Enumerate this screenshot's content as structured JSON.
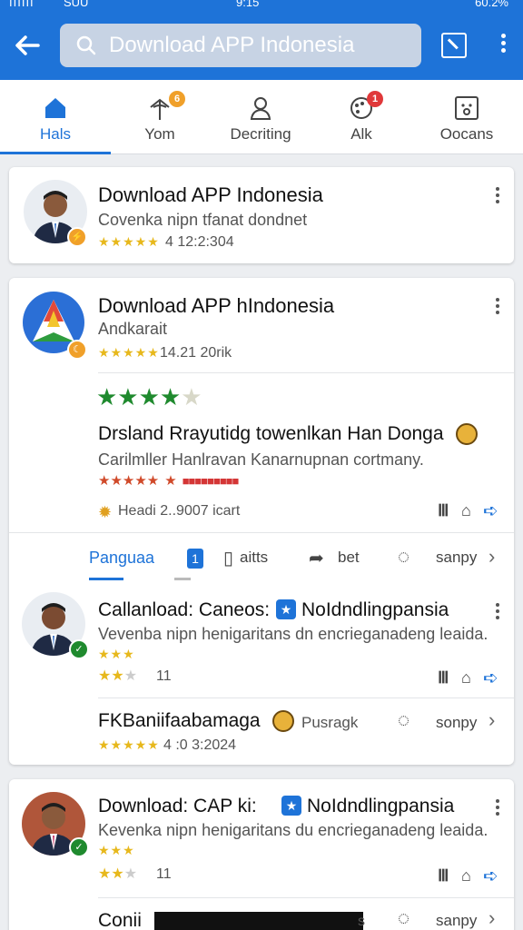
{
  "status_bar": {
    "signal": "IIIIII",
    "carrier": "SUU",
    "clock": "9:15",
    "battery": "60.2%"
  },
  "search": {
    "placeholder": "Download APP Indonesia"
  },
  "icons": {
    "back": "back-arrow-icon",
    "search": "search-icon",
    "screenshot": "crop-icon",
    "more": "more-vert-icon"
  },
  "tabs": [
    {
      "label": "Hals",
      "icon": "home-icon",
      "active": true
    },
    {
      "label": "Yom",
      "icon": "pin-icon",
      "badge": "6"
    },
    {
      "label": "Decriting",
      "icon": "person-icon"
    },
    {
      "label": "Alk",
      "icon": "palette-icon",
      "badge": "1"
    },
    {
      "label": "Oocans",
      "icon": "face-box-icon"
    }
  ],
  "colors": {
    "primary": "#1e73d8",
    "star_yellow": "#e7b81c",
    "star_green": "#1f8a2e",
    "badge_orange": "#f0a02a",
    "badge_red": "#e0383a"
  },
  "card1": {
    "title": "Download APP Indonesia",
    "subtitle": "Covenka nipn tfanat dondnet",
    "stars": "★★★★★",
    "meta": "4 12:2:304"
  },
  "card2": {
    "title": "Download APP hIndonesia",
    "subtitle": "Andkarait",
    "stars": "★★★★★",
    "meta": "14.21 20rik",
    "rating_stars": "★★★★",
    "rating_empty": "★",
    "headline": "Drsland Rrayutidg towenlkan Han Donga",
    "description": "Carilmller Hanlravan Kanarnupnan cortmany.",
    "red_stars": "★★★★★",
    "red_extra": "★",
    "red_tag": "■■■■■■■■■",
    "reads": "Headi  2..9007 icart",
    "actions": {
      "tab1": "Panguaa",
      "count": "1",
      "comments": "aitts",
      "share": "bet",
      "reply": "sanpy"
    }
  },
  "comment1": {
    "title": "Callanload: Caneos:",
    "title2": "NoIdndlingpansia",
    "subtitle": "Vevenba nipn henigaritans dn encrieganadeng leaida.",
    "stars1": "★★★",
    "stars2_filled": "★★",
    "stars2_empty": "★",
    "count": "11",
    "footer_title": "FKBaniifaabamaga",
    "footer_tag": "Pusragk",
    "footer_reply": "sonpy",
    "footer_stars": "★★★★★",
    "footer_meta": "4 :0 3:2024"
  },
  "card3": {
    "title": "Download: CAP ki:",
    "title2": "NoIdndlingpansia",
    "subtitle": "Kevenka nipn henigaritans du encrieganadeng leaida.",
    "stars1": "★★★",
    "stars2_filled": "★★",
    "stars2_empty": "★",
    "count": "11",
    "footer_title": "Conii",
    "footer_tag": "s",
    "footer_reply": "sanpy"
  }
}
